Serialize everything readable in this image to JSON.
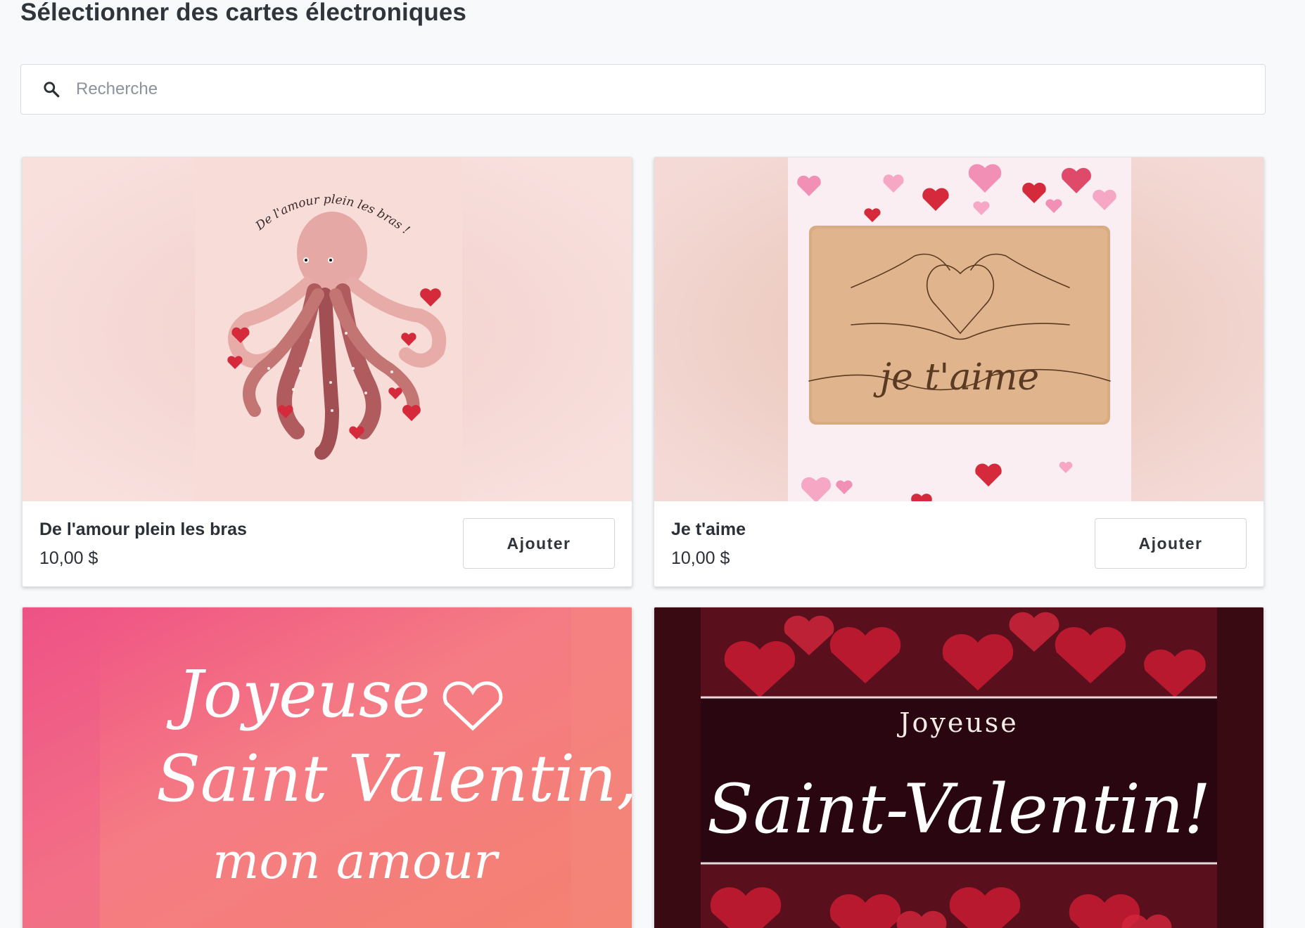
{
  "page": {
    "title": "Sélectionner des cartes électroniques"
  },
  "search": {
    "placeholder": "Recherche",
    "value": ""
  },
  "cards": [
    {
      "name": "De l'amour plein les bras",
      "price": "10,00 $",
      "button_label": "Ajouter",
      "image_text": "De l'amour plein les bras !"
    },
    {
      "name": "Je t'aime",
      "price": "10,00 $",
      "button_label": "Ajouter",
      "image_text": "je t'aime"
    },
    {
      "image_text_line1": "Joyeuse",
      "image_text_line2": "Saint Valentin,",
      "image_text_line3": "mon amour"
    },
    {
      "image_text_line1": "Joyeuse",
      "image_text_line2": "Saint-Valentin!"
    }
  ],
  "colors": {
    "heart_red": "#d42a3c",
    "card_pink_bg": "#f7dcd8",
    "gradient_pink": "#ef4f85",
    "gradient_coral": "#f4826f",
    "dark_red": "#4a0c16"
  },
  "icons": {
    "search": "magnifier"
  }
}
